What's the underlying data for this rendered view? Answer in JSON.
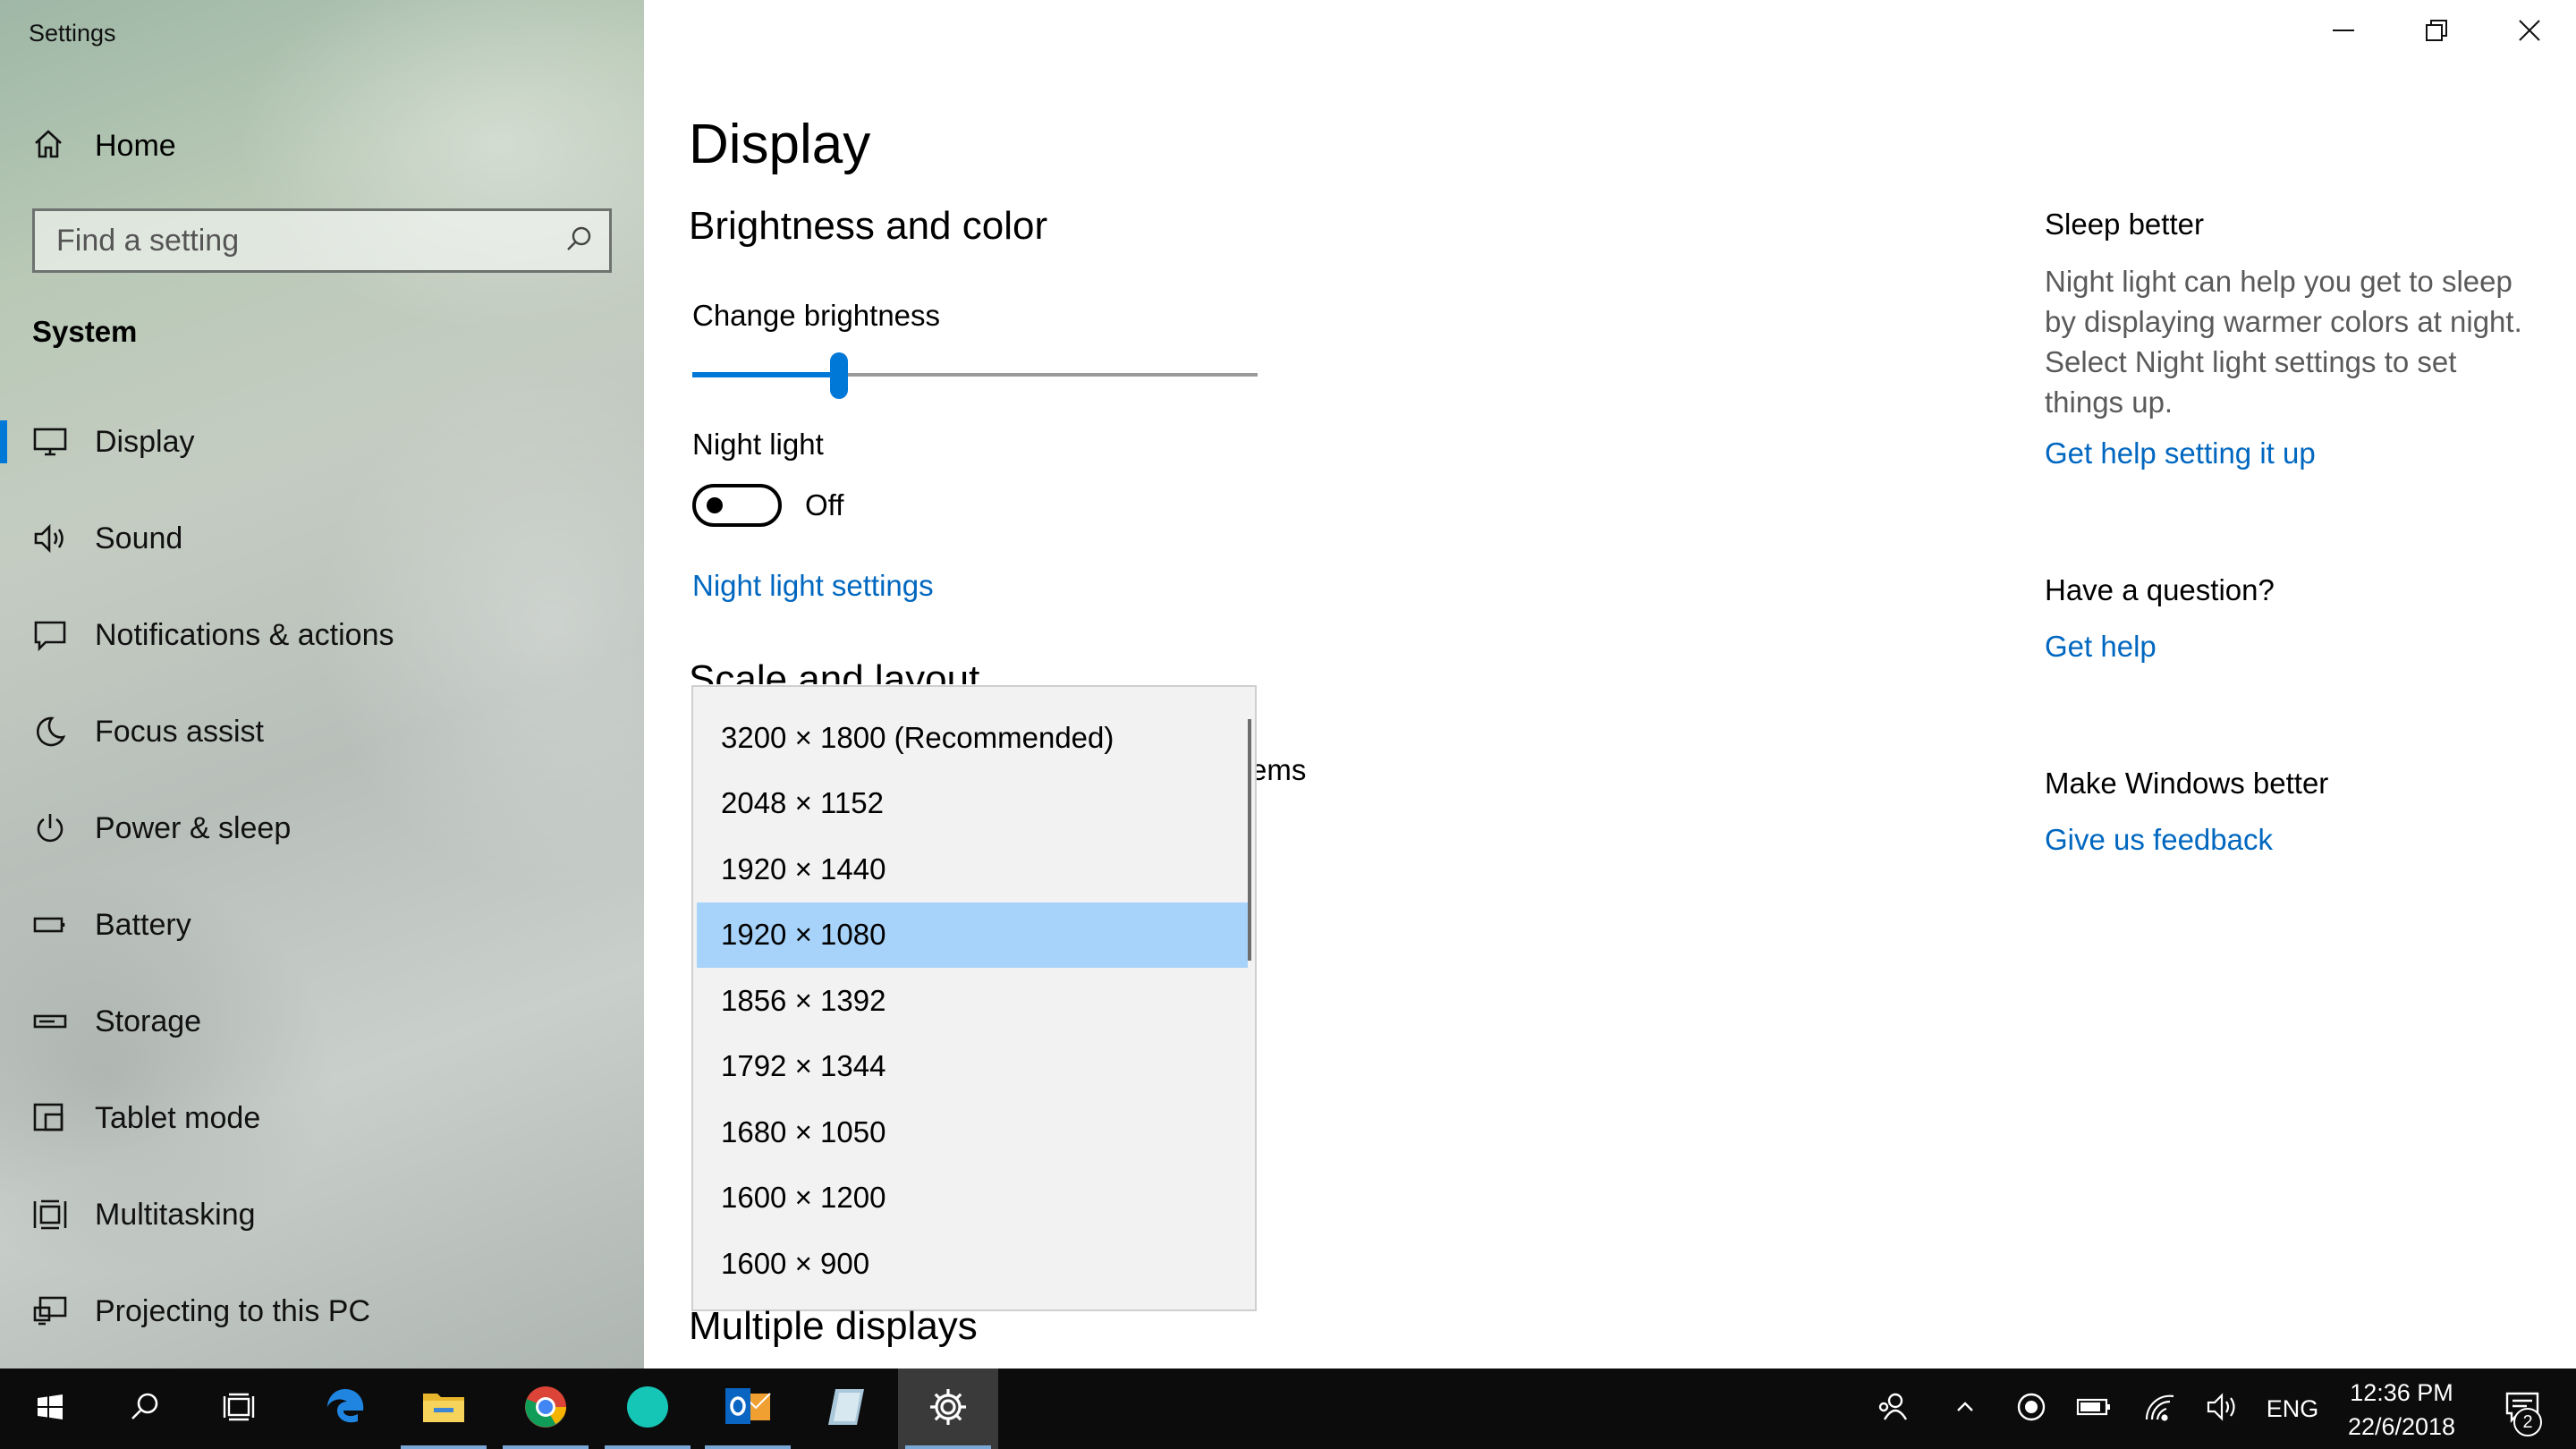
{
  "window": {
    "title": "Settings"
  },
  "sidebar": {
    "home_label": "Home",
    "search_placeholder": "Find a setting",
    "section": "System",
    "items": [
      {
        "label": "Display",
        "icon": "monitor-icon",
        "active": true
      },
      {
        "label": "Sound",
        "icon": "speaker-icon"
      },
      {
        "label": "Notifications & actions",
        "icon": "notifications-icon"
      },
      {
        "label": "Focus assist",
        "icon": "moon-icon"
      },
      {
        "label": "Power & sleep",
        "icon": "power-icon"
      },
      {
        "label": "Battery",
        "icon": "battery-icon"
      },
      {
        "label": "Storage",
        "icon": "storage-icon"
      },
      {
        "label": "Tablet mode",
        "icon": "tablet-mode-icon"
      },
      {
        "label": "Multitasking",
        "icon": "multitasking-icon"
      },
      {
        "label": "Projecting to this PC",
        "icon": "projecting-icon"
      }
    ]
  },
  "main": {
    "page_title": "Display",
    "brightness_heading": "Brightness and color",
    "brightness_label": "Change brightness",
    "brightness_value": 0.26,
    "night_light_label": "Night light",
    "night_light_state": "Off",
    "night_light_settings_link": "Night light settings",
    "scale_heading_partial": "Scale and layout",
    "partial_text": "ems",
    "resolution_options": [
      "3200 × 1800 (Recommended)",
      "2048 × 1152",
      "1920 × 1440",
      "1920 × 1080",
      "1856 × 1392",
      "1792 × 1344",
      "1680 × 1050",
      "1600 × 1200",
      "1600 × 900"
    ],
    "selected_resolution": "1920 × 1080",
    "multiple_displays_heading": "Multiple displays"
  },
  "right_panel": {
    "sleep_heading": "Sleep better",
    "sleep_desc": "Night light can help you get to sleep by displaying warmer colors at night. Select Night light settings to set things up.",
    "sleep_link": "Get help setting it up",
    "question_heading": "Have a question?",
    "question_link": "Get help",
    "feedback_heading": "Make Windows better",
    "feedback_link": "Give us feedback"
  },
  "taskbar": {
    "apps": [
      "start-icon",
      "search-icon",
      "task-view-icon",
      "edge-icon",
      "file-explorer-icon",
      "chrome-icon",
      "app-circle-icon",
      "outlook-icon",
      "note-app-icon",
      "settings-gear-icon"
    ],
    "language": "ENG",
    "time": "12:36 PM",
    "date": "22/6/2018",
    "notification_count": "2"
  },
  "colors": {
    "accent": "#0078d7",
    "link": "#0067c0",
    "selected_item": "#a7d3fa"
  }
}
